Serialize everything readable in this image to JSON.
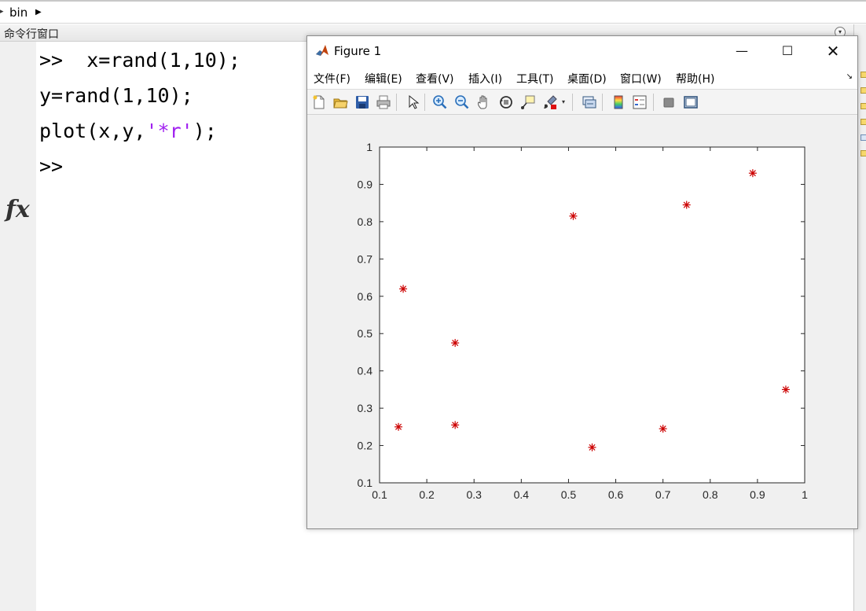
{
  "address_bar": {
    "crumb": "bin"
  },
  "command_window": {
    "panel_title": "命令行窗口",
    "lines": [
      {
        "prompt": ">>",
        "code": "  x=rand(1,10);"
      },
      {
        "code": "y=rand(1,10);"
      },
      {
        "code_before": "plot(x,y,",
        "string_literal": "'*r'",
        "code_after": ");"
      },
      {
        "prompt": ">>"
      }
    ],
    "fx_label": "fx"
  },
  "figure_window": {
    "title": "Figure 1",
    "menus": [
      "文件(F)",
      "编辑(E)",
      "查看(V)",
      "插入(I)",
      "工具(T)",
      "桌面(D)",
      "窗口(W)",
      "帮助(H)"
    ],
    "toolbar_icons": [
      "new-figure-icon",
      "open-file-icon",
      "save-icon",
      "print-icon",
      "edit-plot-cursor-icon",
      "zoom-in-icon",
      "zoom-out-icon",
      "pan-icon",
      "rotate-3d-icon",
      "data-cursor-icon",
      "brush-icon",
      "link-plot-icon",
      "colorbar-icon",
      "legend-icon",
      "hide-plot-tools-icon",
      "show-plot-tools-icon"
    ]
  },
  "chart_data": {
    "type": "scatter",
    "marker": "*",
    "color": "#cc0000",
    "xlim": [
      0.1,
      1
    ],
    "ylim": [
      0.1,
      1
    ],
    "xticks": [
      "0.1",
      "0.2",
      "0.3",
      "0.4",
      "0.5",
      "0.6",
      "0.7",
      "0.8",
      "0.9",
      "1"
    ],
    "yticks": [
      "0.1",
      "0.2",
      "0.3",
      "0.4",
      "0.5",
      "0.6",
      "0.7",
      "0.8",
      "0.9",
      "1"
    ],
    "x": [
      0.14,
      0.15,
      0.26,
      0.26,
      0.51,
      0.55,
      0.7,
      0.75,
      0.89,
      0.96
    ],
    "y": [
      0.25,
      0.62,
      0.255,
      0.475,
      0.815,
      0.195,
      0.245,
      0.845,
      0.93,
      0.35
    ]
  }
}
